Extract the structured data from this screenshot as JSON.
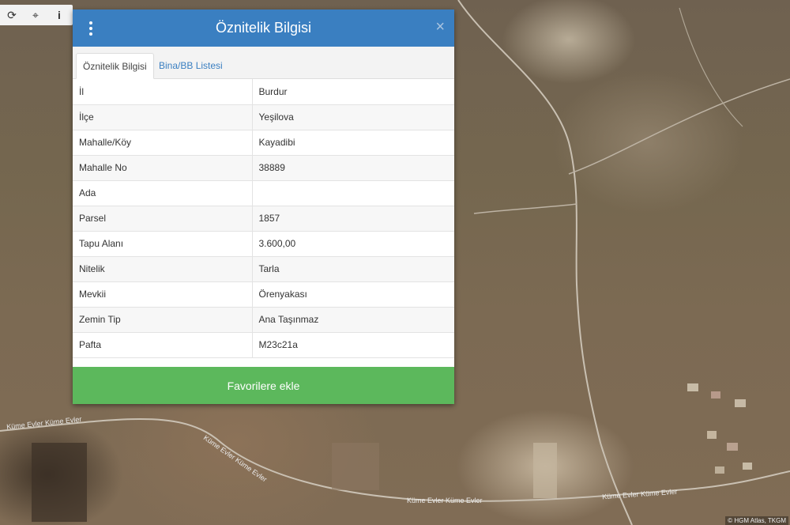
{
  "toolbar": {
    "icons": [
      "refresh-icon",
      "locate-icon",
      "info-icon"
    ],
    "glyphs": [
      "⟳",
      "⌖",
      "i"
    ]
  },
  "panel": {
    "title": "Öznitelik Bilgisi",
    "close": "×",
    "tabs": [
      {
        "label": "Öznitelik Bilgisi",
        "active": true
      },
      {
        "label": "Bina/BB Listesi",
        "active": false
      }
    ],
    "rows": [
      {
        "key": "İl",
        "value": "Burdur"
      },
      {
        "key": "İlçe",
        "value": "Yeşilova"
      },
      {
        "key": "Mahalle/Köy",
        "value": "Kayadibi"
      },
      {
        "key": "Mahalle No",
        "value": "38889"
      },
      {
        "key": "Ada",
        "value": ""
      },
      {
        "key": "Parsel",
        "value": "1857"
      },
      {
        "key": "Tapu Alanı",
        "value": "3.600,00"
      },
      {
        "key": "Nitelik",
        "value": "Tarla"
      },
      {
        "key": "Mevkii",
        "value": "Örenyakası"
      },
      {
        "key": "Zemin Tip",
        "value": "Ana Taşınmaz"
      },
      {
        "key": "Pafta",
        "value": "M23c21a"
      }
    ],
    "favorite_button": "Favorilere ekle"
  },
  "map": {
    "road_labels": [
      "Küme Evler Küme Evler",
      "Küme Evler Küme Evler",
      "Küme Evler Küme Evler",
      "Küme Evler Küme Evler"
    ],
    "attribution": "© HGM Atlas, TKGM"
  },
  "colors": {
    "header": "#3a7fc1",
    "favorite": "#5cb85c",
    "tab_link": "#3a7fc1"
  }
}
